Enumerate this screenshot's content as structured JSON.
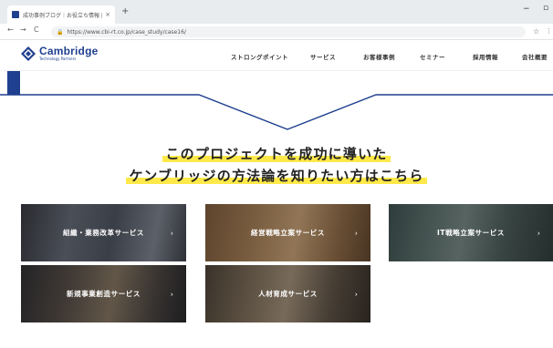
{
  "browser": {
    "tab_title": "成功事例ブログ｜お役立ち情報 | ...",
    "tab_close": "×",
    "new_tab": "+",
    "minimize": "−",
    "maximize": "▫",
    "back": "←",
    "forward": "→",
    "reload": "C",
    "lock": "🔒",
    "url": "https://www.cbi-rt.co.jp/case_study/case16/",
    "star": "☆",
    "ext": "⋮"
  },
  "site": {
    "logo": "Cambridge",
    "logo_sub": "Technology Partners",
    "nav": [
      "ストロングポイント",
      "サービス",
      "お客様事例",
      "セミナー",
      "採用情報",
      "会社概要"
    ]
  },
  "heading": {
    "line1": "このプロジェクトを成功に導いた",
    "line2": "ケンブリッジの方法論を知りたい方はこちら"
  },
  "services": [
    {
      "label": "組織・業務改革サービス",
      "arrow": "›"
    },
    {
      "label": "経営戦略立案サービス",
      "arrow": "›"
    },
    {
      "label": "IT戦略立案サービス",
      "arrow": "›"
    },
    {
      "label": "新規事業創造サービス",
      "arrow": "›"
    },
    {
      "label": "人材育成サービス",
      "arrow": "›"
    }
  ],
  "colors": {
    "brand": "#1f3f8f",
    "highlight": "#ffe94a"
  }
}
